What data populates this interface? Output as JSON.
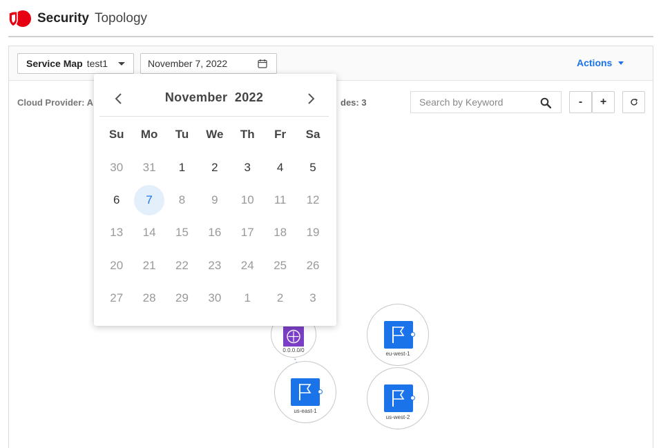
{
  "app": {
    "title_part1": "Security",
    "title_part2": "Topology"
  },
  "toolbar": {
    "service_map_label": "Service Map",
    "service_map_value": "test1",
    "date_value": "November 7, 2022",
    "actions_label": "Actions"
  },
  "info": {
    "cloud_provider_label": "Cloud Provider: A",
    "nodes_label": "des: 3"
  },
  "search": {
    "placeholder": "Search by Keyword"
  },
  "zoom": {
    "minus": "-",
    "plus": "+"
  },
  "calendar": {
    "month": "November",
    "year": "2022",
    "weekdays": [
      "Su",
      "Mo",
      "Tu",
      "We",
      "Th",
      "Fr",
      "Sa"
    ],
    "days": [
      {
        "d": "30",
        "in_month": false
      },
      {
        "d": "31",
        "in_month": false
      },
      {
        "d": "1",
        "in_month": true
      },
      {
        "d": "2",
        "in_month": true
      },
      {
        "d": "3",
        "in_month": true
      },
      {
        "d": "4",
        "in_month": true
      },
      {
        "d": "5",
        "in_month": true
      },
      {
        "d": "6",
        "in_month": true
      },
      {
        "d": "7",
        "in_month": true,
        "selected": true
      },
      {
        "d": "8",
        "in_month": false
      },
      {
        "d": "9",
        "in_month": false
      },
      {
        "d": "10",
        "in_month": false
      },
      {
        "d": "11",
        "in_month": false
      },
      {
        "d": "12",
        "in_month": false
      },
      {
        "d": "13",
        "in_month": false
      },
      {
        "d": "14",
        "in_month": false
      },
      {
        "d": "15",
        "in_month": false
      },
      {
        "d": "16",
        "in_month": false
      },
      {
        "d": "17",
        "in_month": false
      },
      {
        "d": "18",
        "in_month": false
      },
      {
        "d": "19",
        "in_month": false
      },
      {
        "d": "20",
        "in_month": false
      },
      {
        "d": "21",
        "in_month": false
      },
      {
        "d": "22",
        "in_month": false
      },
      {
        "d": "23",
        "in_month": false
      },
      {
        "d": "24",
        "in_month": false
      },
      {
        "d": "25",
        "in_month": false
      },
      {
        "d": "26",
        "in_month": false
      },
      {
        "d": "27",
        "in_month": false
      },
      {
        "d": "28",
        "in_month": false
      },
      {
        "d": "29",
        "in_month": false
      },
      {
        "d": "30",
        "in_month": false
      },
      {
        "d": "1",
        "in_month": false
      },
      {
        "d": "2",
        "in_month": false
      },
      {
        "d": "3",
        "in_month": false
      }
    ]
  },
  "nodes": {
    "gateway_label": "0.0.0.0/0",
    "us_east_1": "us-east-1",
    "eu_west_1": "eu-west-1",
    "us_west_2": "us-west-2"
  },
  "colors": {
    "accent": "#1a73e8",
    "brand": "#e60012",
    "gateway": "#7b3fc6"
  }
}
